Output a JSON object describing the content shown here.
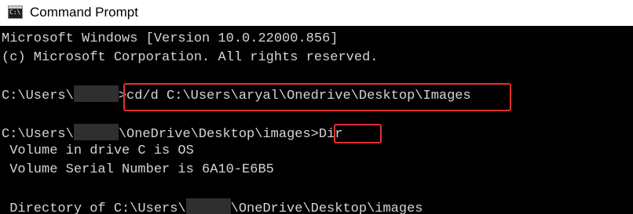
{
  "window": {
    "title": "Command Prompt",
    "icon": "terminal-icon",
    "title_bar_color": "#ffffff",
    "background_color": "#000000",
    "text_color": "#d4d4d4",
    "highlight_color": "#e0312f"
  },
  "console": {
    "banner_version": "Microsoft Windows [Version 10.0.22000.856]",
    "banner_copyright": "(c) Microsoft Corporation. All rights reserved.",
    "prompt1_prefix": "C:\\Users\\",
    "prompt1_suffix": ">",
    "command1": "cd/d C:\\Users\\aryal\\Onedrive\\Desktop\\Images",
    "prompt2_prefix": "C:\\Users\\",
    "prompt2_suffix": "\\OneDrive\\Desktop\\images>",
    "command2": "Dir",
    "volume_line": " Volume in drive C is OS",
    "serial_line": " Volume Serial Number is 6A10-E6B5",
    "directory_prefix": " Directory of C:\\Users\\",
    "directory_suffix": "\\OneDrive\\Desktop\\images"
  }
}
